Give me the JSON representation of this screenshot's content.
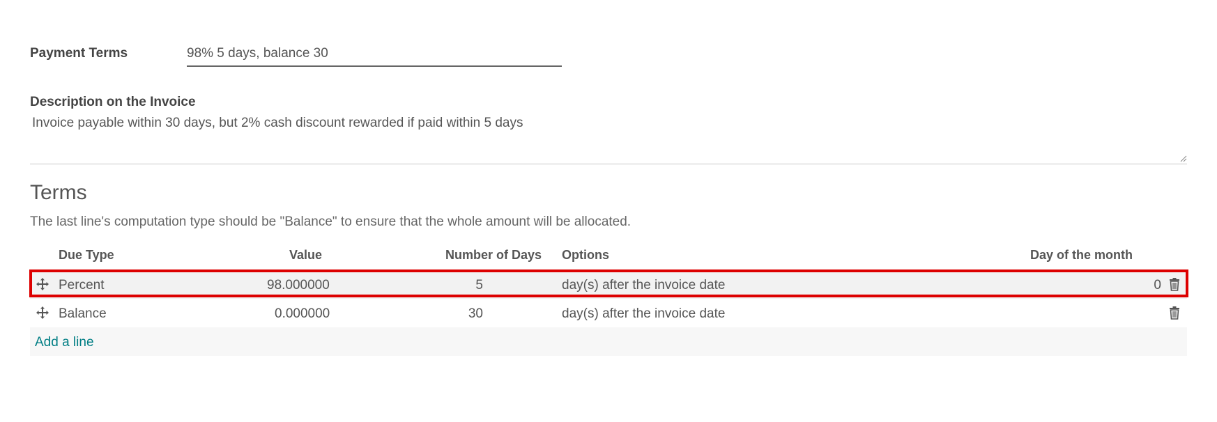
{
  "payment_terms": {
    "label": "Payment Terms",
    "value": "98% 5 days, balance 30"
  },
  "description": {
    "label": "Description on the Invoice",
    "value": "Invoice payable within 30 days, but 2% cash discount rewarded if paid within 5 days"
  },
  "terms": {
    "title": "Terms",
    "note": "The last line's computation type should be \"Balance\" to ensure that the whole amount will be allocated.",
    "columns": {
      "due_type": "Due Type",
      "value": "Value",
      "days": "Number of Days",
      "options": "Options",
      "day_of_month": "Day of the month"
    },
    "rows": [
      {
        "due_type": "Percent",
        "value": "98.000000",
        "days": "5",
        "options": "day(s) after the invoice date",
        "day_of_month": "0",
        "highlighted": true
      },
      {
        "due_type": "Balance",
        "value": "0.000000",
        "days": "30",
        "options": "day(s) after the invoice date",
        "day_of_month": "",
        "highlighted": false
      }
    ],
    "add_line": "Add a line"
  },
  "colors": {
    "accent": "#017e84",
    "highlight_border": "#dd0000"
  },
  "icons": {
    "drag_handle": "move-arrows-icon",
    "delete": "trash-icon"
  }
}
